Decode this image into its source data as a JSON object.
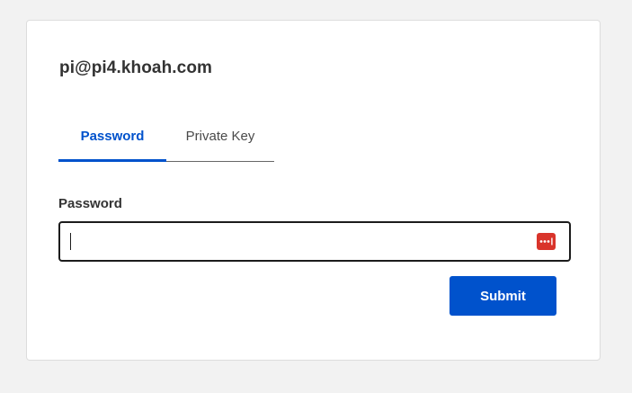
{
  "login": {
    "host": "pi@pi4.khoah.com",
    "tabs": [
      {
        "label": "Password",
        "active": true
      },
      {
        "label": "Private Key",
        "active": false
      }
    ],
    "password_label": "Password",
    "password_value": "",
    "submit_label": "Submit"
  },
  "icons": {
    "password_manager": "password-manager-icon"
  },
  "colors": {
    "accent": "#0052cc",
    "background": "#f2f2f2",
    "card": "#ffffff",
    "password_manager_icon": "#d9342b"
  }
}
